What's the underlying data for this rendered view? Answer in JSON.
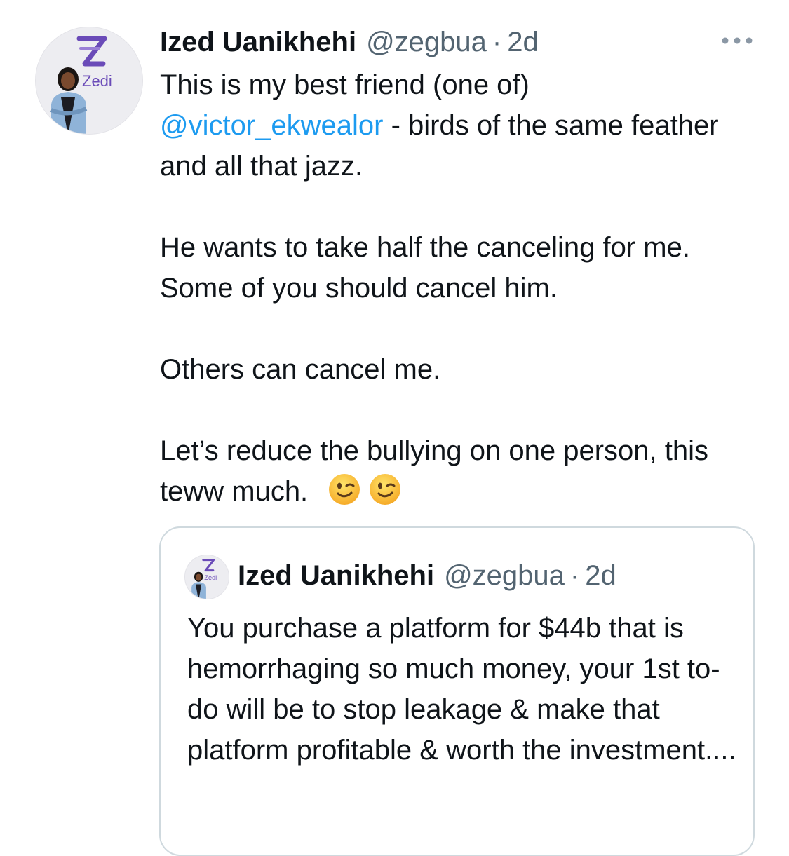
{
  "tweet": {
    "author_name": "Ized Uanikhehi",
    "handle": "@zegbua",
    "separator": "·",
    "time": "2d",
    "more_icon": "ellipsis-icon",
    "avatar_brand_text": "Zedi",
    "text": {
      "line1": "This is my best friend (one of)",
      "mention": "@victor_ekwealor",
      "after_mention": " - birds of the same feather and all that jazz.",
      "para2": "He wants to take half the canceling for me. Some of you should cancel him.",
      "para3": "Others can cancel me.",
      "para4": "Let’s reduce the bullying on one person, this teww much."
    },
    "emoji": [
      "winking-face-emoji",
      "winking-face-emoji"
    ],
    "colors": {
      "link": "#1d9bf0",
      "secondary_text": "#536471",
      "border": "#cfd9de",
      "brand_purple": "#6a4bb8"
    }
  },
  "quoted_tweet": {
    "author_name": "Ized Uanikhehi",
    "handle": "@zegbua",
    "separator": "·",
    "time": "2d",
    "avatar_brand_text": "Zedi",
    "text": "You purchase a platform for $44b that is hemorrhaging so much money, your 1st to-do will be to stop leakage & make that platform profitable & worth the investment...."
  }
}
